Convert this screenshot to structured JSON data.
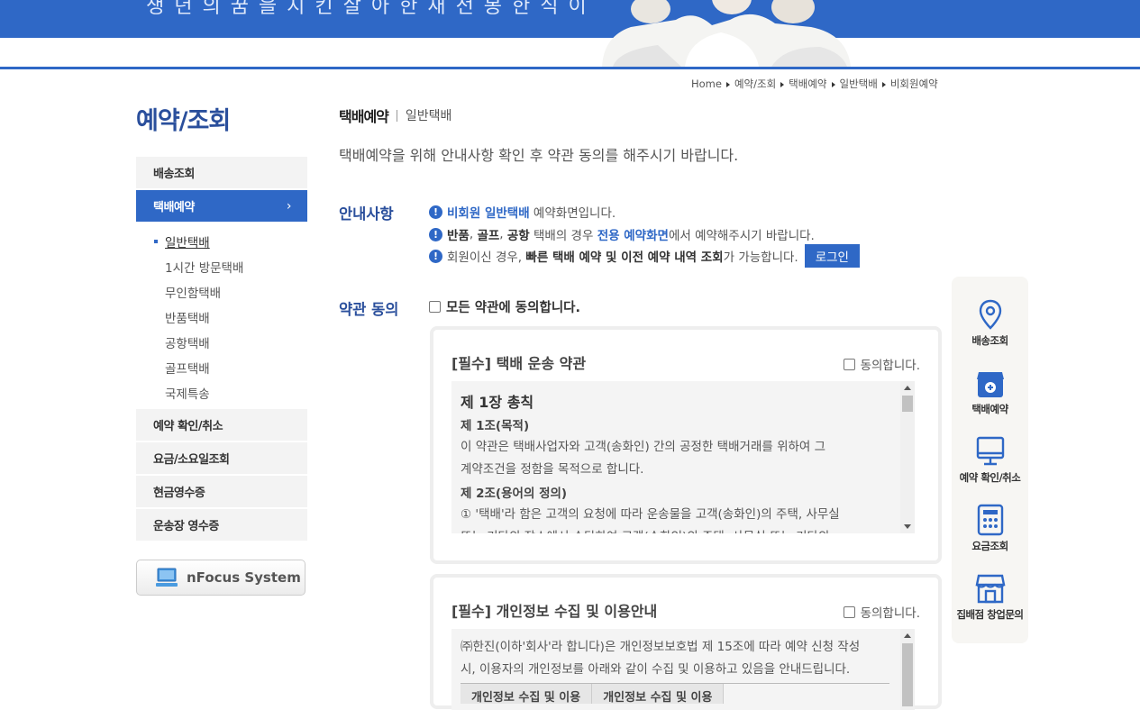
{
  "banner": {
    "slogan": "생 년 의 꿈 을 지 킨 살 아 한 새 전 봉 한 식 이"
  },
  "breadcrumb": [
    "Home",
    "예약/조회",
    "택배예약",
    "일반택배",
    "비회원예약"
  ],
  "sidebar": {
    "title": "예약/조회",
    "items": [
      {
        "label": "배송조회"
      },
      {
        "label": "택배예약",
        "chevron": "›"
      },
      {
        "label": "예약 확인/취소"
      },
      {
        "label": "요금/소요일조회"
      },
      {
        "label": "현금영수증"
      },
      {
        "label": "운송장 영수증"
      }
    ],
    "sub_items": [
      "일반택배",
      "1시간 방문택배",
      "무인함택배",
      "반품택배",
      "공항택배",
      "골프택배",
      "국제특송"
    ],
    "nfocus": "nFocus System"
  },
  "main": {
    "title": "택배예약",
    "subtitle": "일반택배",
    "intro": "택배예약을 위해 안내사항 확인 후 약관 동의를 해주시기 바랍니다.",
    "notice_label": "안내사항",
    "notices": {
      "n1_highlight": "비회원 일반택배",
      "n1_rest": " 예약화면입니다.",
      "n2_a": "반품",
      "n2_b": ", ",
      "n2_c": "골프",
      "n2_d": ", ",
      "n2_e": "공항",
      "n2_f": " 택배의 경우 ",
      "n2_highlight": "전용 예약화면",
      "n2_g": "에서 예약해주시기 바랍니다.",
      "n3_a": "회원이신 경우, ",
      "n3_bold": "빠른 택배 예약 및 이전 예약 내역 조회",
      "n3_rest": "가 가능합니다.",
      "login_button": "로그인"
    },
    "terms_label": "약관 동의",
    "agree_all": "모든 약관에 동의합니다.",
    "terms": [
      {
        "title": "[필수] 택배 운송 약관",
        "agree": "동의합니다.",
        "chapter": "제 1장 총칙",
        "article1": "제 1조(목적)",
        "text1a": "이 약관은 택배사업자와 고객(송화인) 간의 공정한 택배거래를 위하여 그",
        "text1b": "계약조건을 정함을 목적으로 합니다.",
        "article2": "제 2조(용어의 정의)",
        "text2a": "① '택배'라 함은 고객의 요청에 따라 운송물을 고객(송화인)의 주택, 사무실",
        "text2b": "또는 기타의 장소에서 수탁하여 고객(수화인)의 주택, 사무실 또는 기타의"
      },
      {
        "title": "[필수] 개인정보 수집 및 이용안내",
        "agree": "동의합니다.",
        "text1a": "㈜한진(이하'회사'라 합니다)은 개인정보보호법 제 15조에 따라 예약 신청 작성",
        "text1b": "시, 이용자의 개인정보를 아래와 같이 수집 및 이용하고 있음을 안내드립니다.",
        "col1": "개인정보 수집 및 이용",
        "col2": "개인정보 수집 및 이용"
      }
    ]
  },
  "quick_menu": [
    {
      "label": "배송조회",
      "icon": "location-pin-icon"
    },
    {
      "label": "택배예약",
      "icon": "box-icon"
    },
    {
      "label": "예약 확인/취소",
      "icon": "monitor-icon"
    },
    {
      "label": "요금조회",
      "icon": "calculator-icon"
    },
    {
      "label": "집배점 창업문의",
      "icon": "store-icon"
    }
  ],
  "colors": {
    "brand_blue": "#2f68c6",
    "title_blue": "#2a4f9c"
  }
}
